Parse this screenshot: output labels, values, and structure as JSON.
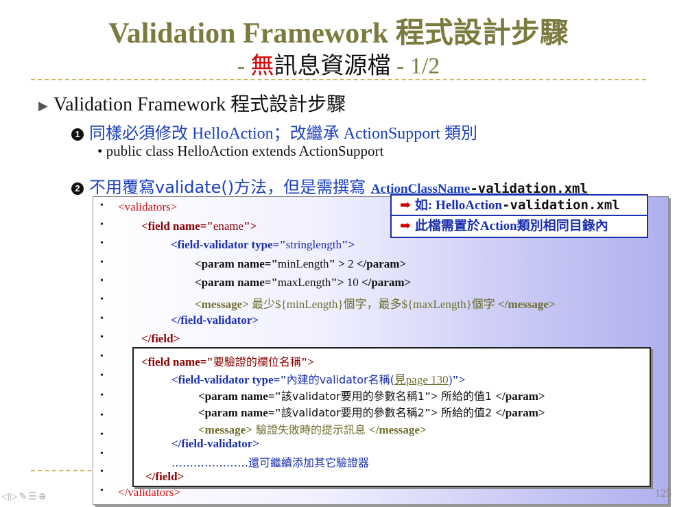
{
  "slide": {
    "title": "Validation Framework 程式設計步驟",
    "subtitle_prefix": "- ",
    "subtitle_red": "無",
    "subtitle_black": "訊息資源檔",
    "subtitle_suffix": " - 1/2",
    "page_number": "125"
  },
  "outline": {
    "level1": "Validation Framework 程式設計步驟",
    "step1_number": "1",
    "step1_text": "同樣必須修改 HelloAction；改繼承 ActionSupport 類別",
    "step1_bullet": "public class HelloAction extends ActionSupport",
    "step2_number": "2",
    "step2_text": "不用覆寫validate()方法，但是需撰寫 ",
    "step2_file_a": "ActionClassName",
    "step2_file_b": "-validation.xml"
  },
  "callout": {
    "row1_prefix": "如: HelloAction",
    "row1_suffix": "-validation.xml",
    "row2": "此檔需置於Action類別相同目錄內"
  },
  "code": {
    "bullet": "•",
    "l1": "<validators>",
    "l2a": "<field",
    "l2b": " name=\"",
    "l2c": "ename",
    "l2d": "\">",
    "l3a": "<field-validator type=\"",
    "l3b": "stringlength",
    "l3c": "\">",
    "l4a": "<param name=\"",
    "l4b": "minLength",
    "l4c": "\" > ",
    "l4d": "2",
    "l4e": " </param>",
    "l5a": "<param name=\"",
    "l5b": "maxLength",
    "l5c": "\">",
    "l5d": " 10 ",
    "l5e": "</param>",
    "l6a": "<message>",
    "l6b": " 最少${minLength}個字，最多${maxLength}個字 ",
    "l6c": "</message>",
    "l7": "</field-validator>",
    "l8": "</field>",
    "l_last": "</validators>"
  },
  "template_box": {
    "t1a": "<field name=\"",
    "t1b": "要驗證的欄位名稱",
    "t1c": "\">",
    "t2a": "<field-validator type=\"",
    "t2b": "內建的validator名稱(",
    "t2c": "見page 130",
    "t2d": ")",
    "t2e": "\">",
    "t3a": "<param name=\"",
    "t3b": "該validator要用的參數名稱1",
    "t3c": "\">",
    "t3d": " 所給的值1 ",
    "t3e": "</param>",
    "t4a": "<param name=\"",
    "t4b": "該validator要用的參數名稱2",
    "t4c": "\">",
    "t4d": " 所給的值2 ",
    "t4e": "</param>",
    "t5a": "<message>",
    "t5b": " 驗證失敗時的提示訊息 ",
    "t5c": "</message>",
    "t6": "</field-validator>",
    "t7": "…………………還可繼續添加其它驗證器",
    "t8": "</field>"
  }
}
